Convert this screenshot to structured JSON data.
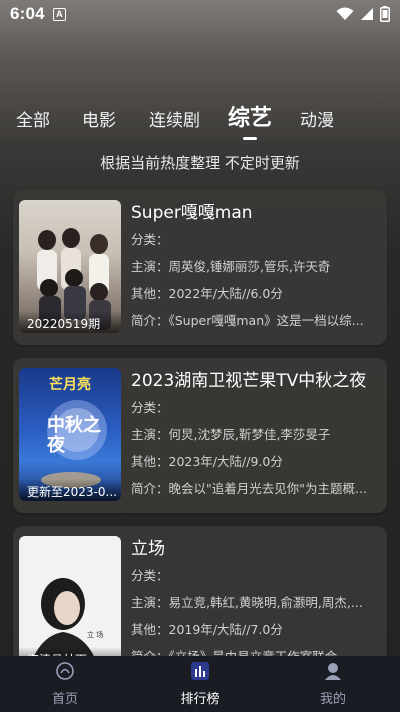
{
  "status": {
    "time": "6:04",
    "notif_letter": "A"
  },
  "tabs": {
    "items": [
      {
        "label": "全部"
      },
      {
        "label": "电影"
      },
      {
        "label": "连续剧"
      },
      {
        "label": "综艺"
      },
      {
        "label": "动漫"
      }
    ],
    "active_index": 3
  },
  "subtitle": "根据当前热度整理 不定时更新",
  "cards": [
    {
      "title": "Super嘎嘎man",
      "poster_caption": "20220519期",
      "category": "分类：",
      "cast": "主演：周英俊,锤娜丽莎,管乐,许天奇",
      "other": "其他：2022年/大陆//6.0分",
      "intro": "简介：《Super嘎嘎man》这是一档以综..."
    },
    {
      "title": "2023湖南卫视芒果TV中秋之夜",
      "poster_caption": "更新至2023-0...",
      "category": "分类：",
      "cast": "主演：何炅,沈梦辰,靳梦佳,李莎旻子",
      "other": "其他：2023年/大陆//9.0分",
      "intro": "简介：晚会以\"追着月光去见你\"为主题概..."
    },
    {
      "title": "立场",
      "poster_caption": "海清县林下",
      "category": "分类：",
      "cast": "主演：易立竞,韩红,黄晓明,俞灏明,周杰,...",
      "other": "其他：2019年/大陆//7.0分",
      "intro": "简介：《立场》是由易立竞工作室联合..."
    }
  ],
  "poster_texts": {
    "mango_logo": "芒月亮",
    "mid_autumn": "中秋之夜",
    "lichang": "立 场"
  },
  "bottom_nav": [
    {
      "label": "首页",
      "icon": "home-icon"
    },
    {
      "label": "排行榜",
      "icon": "ranking-icon"
    },
    {
      "label": "我的",
      "icon": "profile-icon"
    }
  ],
  "colors": {
    "card_bg": "#3a3836",
    "bottom_bar": "#1a1c24",
    "nav_inactive": "#9aa0b8"
  }
}
